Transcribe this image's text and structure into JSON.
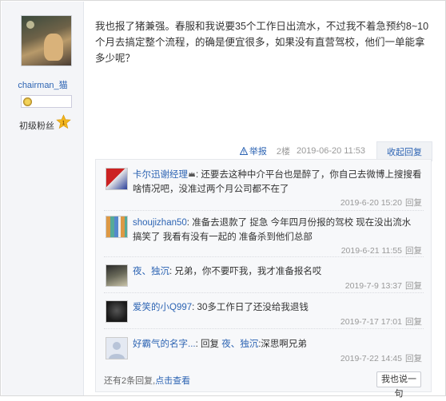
{
  "author": {
    "username": "chairman_猫",
    "fan_level_label": "初级粉丝",
    "fan_level_number": "1",
    "avatar_icon": "cat-photo-avatar"
  },
  "post": {
    "content": "我也报了猪兼强。春服和我说要35个工作日出流水，不过我不着急预约8~10个月去搞定整个流程，的确是便宜很多，如果没有直营驾校，他们一单能拿多少呢？",
    "report_label": "举报",
    "floor": "2楼",
    "time": "2019-06-20 11:53",
    "collapse_label": "收起回复"
  },
  "comments": [
    {
      "name": "卡尔迅谢经理",
      "separator": ":",
      "text": "还要去这种中介平台也是醉了，你自己去微博上搜搜看啥情况吧，没准过两个月公司都不在了",
      "time": "2019-6-20 15:20",
      "reply": "回复"
    },
    {
      "name": "shoujizhan50",
      "separator": ":",
      "text": "准备去退款了 捉急 今年四月份报的驾校 现在没出流水 搞笑了 我看有没有一起的 准备杀到他们总部",
      "time": "2019-6-21 11:55",
      "reply": "回复"
    },
    {
      "name": "夜、独沉",
      "separator": ":",
      "text": "兄弟，你不要吓我，我才准备报名哎",
      "time": "2019-7-9 13:37",
      "reply": "回复"
    },
    {
      "name": "爱笑的小Q997",
      "separator": ":",
      "text": "30多工作日了还没给我退钱",
      "time": "2019-7-17 17:01",
      "reply": "回复"
    },
    {
      "name": "好霸气的名字...",
      "separator": ":",
      "text_prefix": "回复 ",
      "reply_to": "夜、独沉",
      "text": ":深思啊兄弟",
      "time": "2019-7-22 14:45",
      "reply": "回复"
    }
  ],
  "footer": {
    "more_prefix": "还有2条回复,",
    "more_link": "点击查看",
    "reply_button": "我也说一句"
  },
  "colors": {
    "link": "#2d64b3",
    "sidebar_bg": "#f4f5f8",
    "comment_bg": "#f7f8fa"
  }
}
